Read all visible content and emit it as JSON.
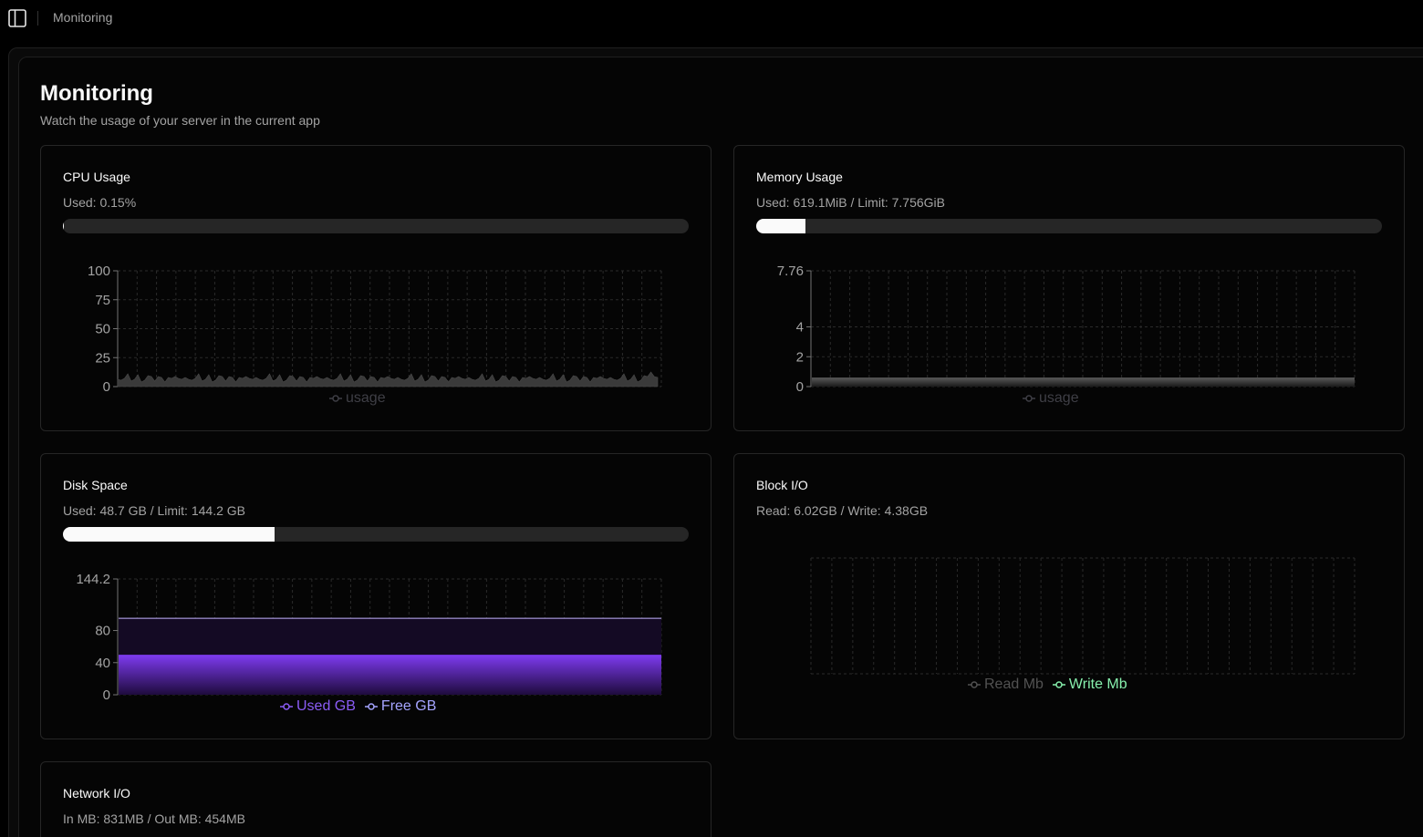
{
  "topbar": {
    "title": "Monitoring",
    "toggle_icon": "sidebar-panel-icon"
  },
  "page": {
    "title": "Monitoring",
    "subtitle": "Watch the usage of your server in the current app"
  },
  "cpu": {
    "title": "CPU Usage",
    "stat": "Used: 0.15%",
    "progress_pct": 0.15,
    "chart_data": {
      "type": "area",
      "series": [
        {
          "name": "usage",
          "color": "#3f3f46"
        }
      ],
      "y_ticks": [
        "100",
        "75",
        "50",
        "25",
        "0"
      ],
      "ylim": [
        0,
        100
      ],
      "legend": [
        "usage"
      ]
    }
  },
  "memory": {
    "title": "Memory Usage",
    "stat": "Used: 619.1MiB / Limit: 7.756GiB",
    "progress_pct": 7.8,
    "chart_data": {
      "type": "area",
      "series": [
        {
          "name": "usage",
          "color": "#3f3f46"
        }
      ],
      "y_ticks": [
        "7.76",
        "4",
        "2",
        "0"
      ],
      "ylim": [
        0,
        7.76
      ],
      "legend": [
        "usage"
      ]
    }
  },
  "disk": {
    "title": "Disk Space",
    "stat": "Used: 48.7 GB / Limit: 144.2 GB",
    "progress_pct": 33.8,
    "chart_data": {
      "type": "area",
      "series": [
        {
          "name": "Used GB",
          "value": 48.7,
          "color": "#7c3aed"
        },
        {
          "name": "Free GB",
          "value": 95.5,
          "color": "#a78bfa"
        }
      ],
      "y_ticks": [
        "144.2",
        "80",
        "40",
        "0"
      ],
      "ylim": [
        0,
        144.2
      ],
      "legend": [
        "Used GB",
        "Free GB"
      ]
    }
  },
  "block_io": {
    "title": "Block I/O",
    "stat": "Read: 6.02GB / Write: 4.38GB",
    "chart_data": {
      "type": "line",
      "series": [
        {
          "name": "Read Mb",
          "color": "#525252"
        },
        {
          "name": "Write Mb",
          "color": "#86efac"
        }
      ],
      "legend": [
        "Read Mb",
        "Write Mb"
      ]
    }
  },
  "network": {
    "title": "Network I/O",
    "stat": "In MB: 831MB / Out MB: 454MB"
  },
  "colors": {
    "accent_purple": "#7c3aed",
    "legend_purple": "#8b5cf6",
    "legend_lavender": "#a5a4ff",
    "legend_green": "#86efac",
    "legend_gray": "#525252"
  }
}
